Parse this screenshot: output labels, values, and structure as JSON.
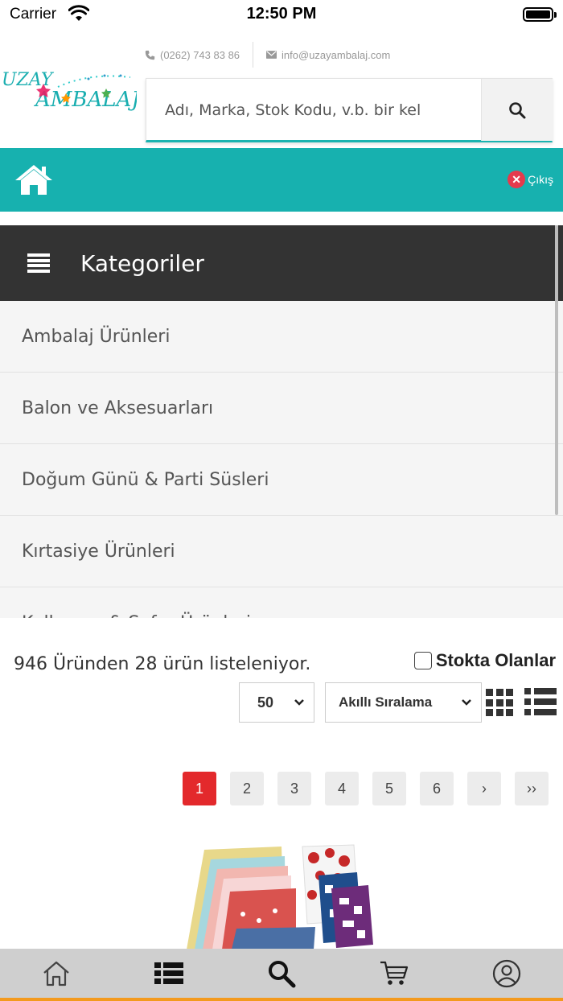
{
  "status_bar": {
    "carrier": "Carrier",
    "time": "12:50 PM"
  },
  "header": {
    "phone": "(0262) 743 83 86",
    "email": "info@uzayambalaj.com",
    "logo_text_top": "UZAY",
    "logo_text_bottom": "AMBALAJ",
    "search_placeholder": "Adı, Marka, Stok Kodu, v.b. bir kel"
  },
  "nav": {
    "logout_label": "Çıkış"
  },
  "categories": {
    "title": "Kategoriler",
    "items": [
      "Ambalaj Ürünleri",
      "Balon ve Aksesuarları",
      "Doğum Günü & Parti Süsleri",
      "Kırtasiye Ürünleri",
      "Kalkınma & Sofra Ürünleri"
    ]
  },
  "listing": {
    "count_text": "946 Üründen 28 ürün listeleniyor.",
    "stock_filter_label": "Stokta Olanlar",
    "per_page": "50",
    "sort": "Akıllı Sıralama"
  },
  "pagination": {
    "pages": [
      "1",
      "2",
      "3",
      "4",
      "5",
      "6"
    ],
    "active_page": "1",
    "next_label": "›",
    "last_label": "››"
  },
  "tab_bar": {
    "items": [
      "home-icon",
      "list-icon",
      "search-icon",
      "cart-icon",
      "account-icon"
    ]
  },
  "colors": {
    "teal": "#17b1af",
    "dark": "#333333",
    "active_page": "#e3292c",
    "accent_bottom": "#f39a1e"
  }
}
